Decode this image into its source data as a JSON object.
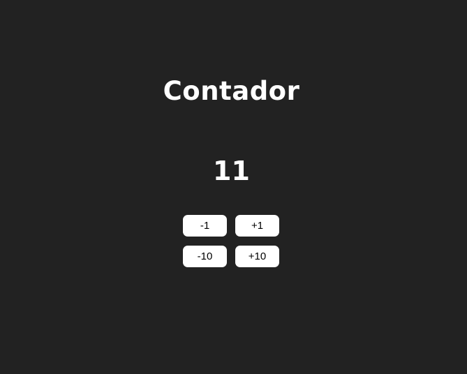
{
  "app": {
    "title": "Contador"
  },
  "counter": {
    "value": "11"
  },
  "controls": {
    "decrement_1": "-1",
    "increment_1": "+1",
    "decrement_10": "-10",
    "increment_10": "+10"
  },
  "colors": {
    "background": "#222222",
    "text": "#ffffff",
    "button_background": "#ffffff",
    "button_text": "#000000"
  }
}
